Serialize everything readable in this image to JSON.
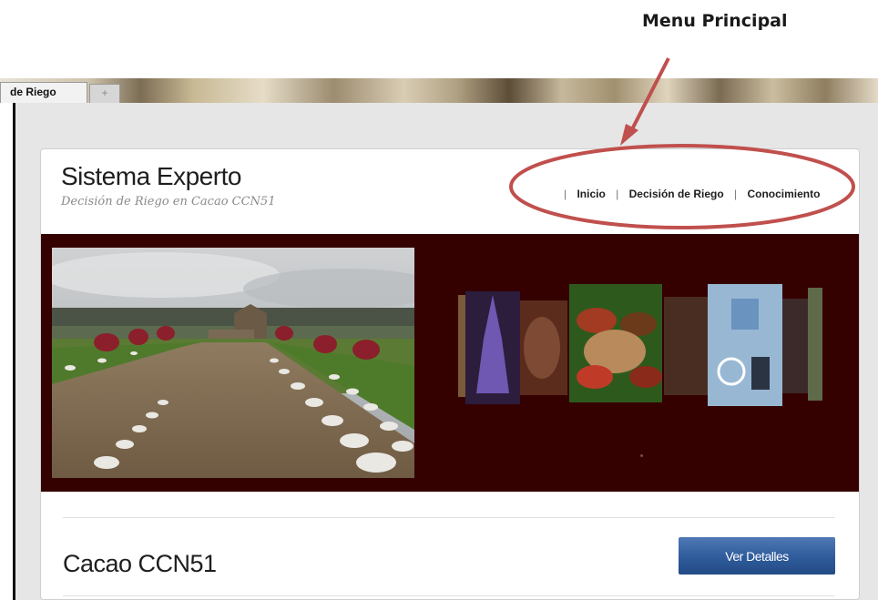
{
  "annotation": {
    "label": "Menu Principal"
  },
  "browser": {
    "tab_label": "de Riego",
    "new_tab_label": "+"
  },
  "site": {
    "title": "Sistema Experto",
    "subtitle": "Decisión de Riego en Cacao CCN51"
  },
  "nav": {
    "separator": "|",
    "items": [
      {
        "label": "Inicio"
      },
      {
        "label": "Decisión de Riego"
      },
      {
        "label": "Conocimiento"
      }
    ]
  },
  "banner": {
    "background_color": "#340000"
  },
  "content": {
    "product_title": "Cacao CCN51",
    "details_button": "Ver Detalles"
  },
  "colors": {
    "accent": "#2f5b9b",
    "annotation": "#c0504d"
  }
}
